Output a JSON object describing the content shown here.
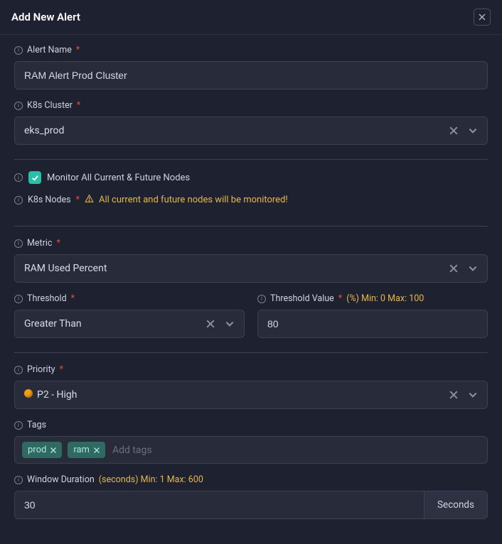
{
  "header": {
    "title": "Add New Alert"
  },
  "alertName": {
    "label": "Alert Name",
    "value": "RAM Alert Prod Cluster"
  },
  "cluster": {
    "label": "K8s Cluster",
    "value": "eks_prod"
  },
  "monitorAll": {
    "label": "Monitor All Current & Future Nodes",
    "checked": true
  },
  "nodes": {
    "label": "K8s Nodes",
    "warning": "All current and future nodes will be monitored!"
  },
  "metric": {
    "label": "Metric",
    "value": "RAM Used Percent"
  },
  "threshold": {
    "label": "Threshold",
    "value": "Greater Than"
  },
  "thresholdValue": {
    "label": "Threshold Value",
    "hint": "(%) Min: 0 Max: 100",
    "value": "80"
  },
  "priority": {
    "label": "Priority",
    "value": "P2 - High"
  },
  "tags": {
    "label": "Tags",
    "items": [
      "prod",
      "ram"
    ],
    "placeholder": "Add tags"
  },
  "windowDuration": {
    "label": "Window Duration",
    "hint": "(seconds) Min: 1 Max: 600",
    "value": "30",
    "unit": "Seconds"
  }
}
